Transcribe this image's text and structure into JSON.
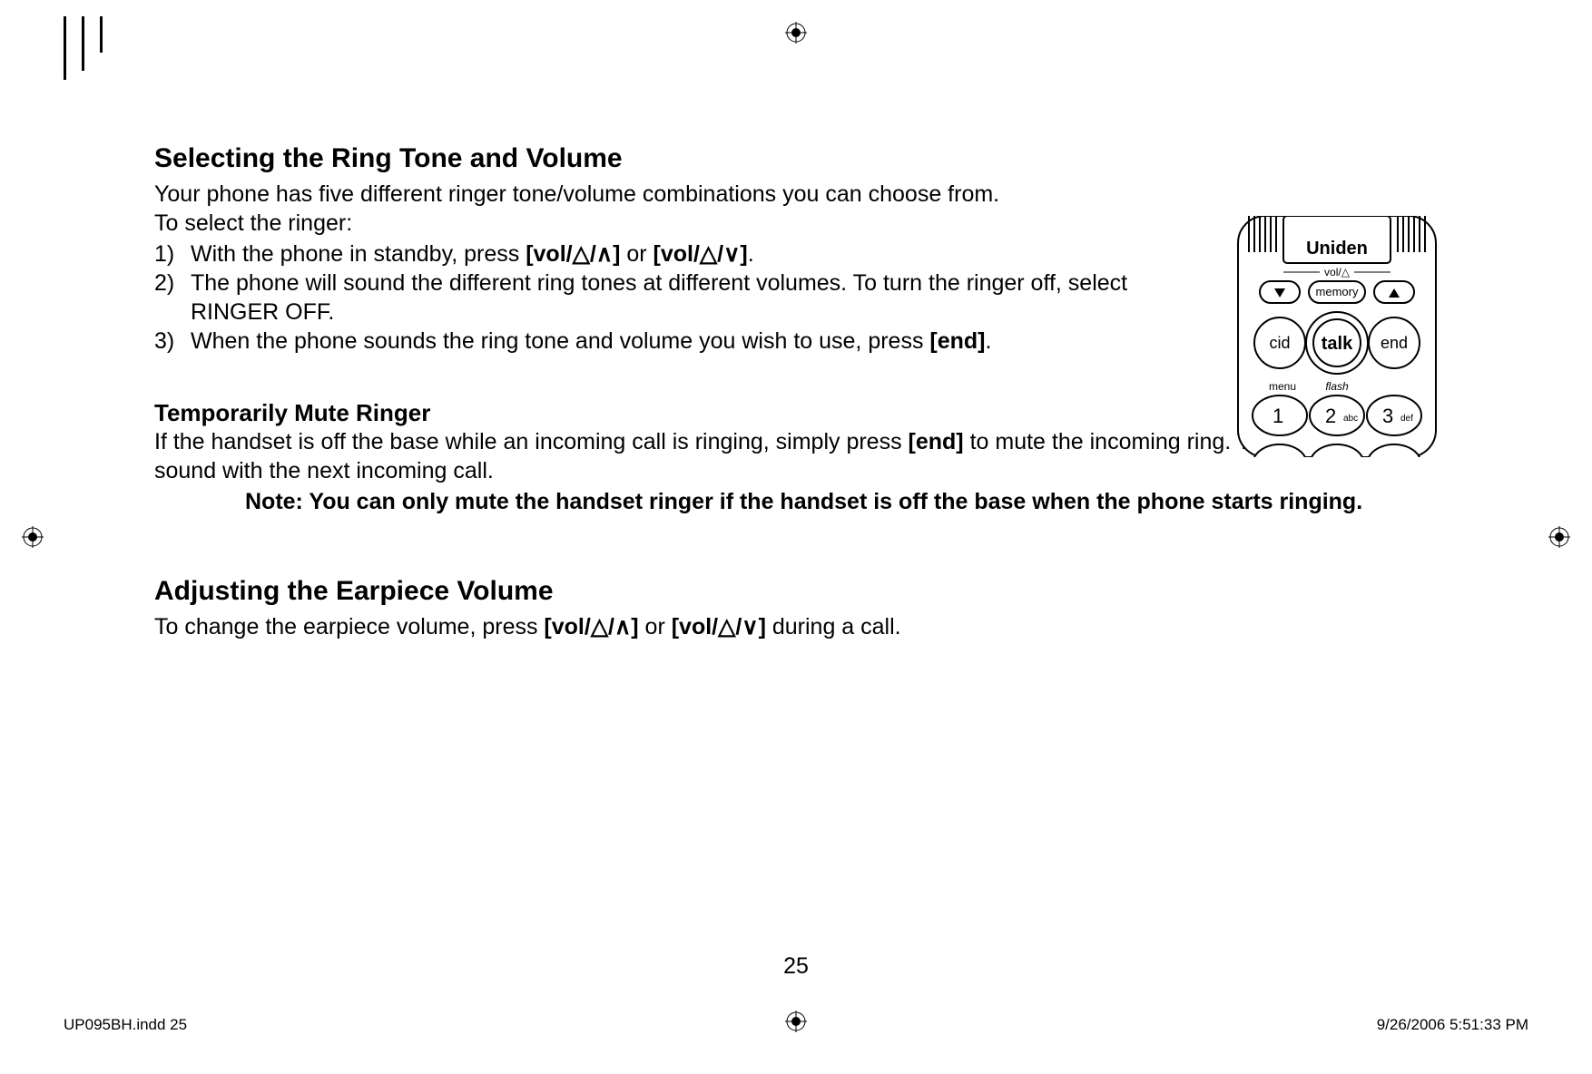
{
  "headings": {
    "h1_a": "Selecting the Ring Tone and Volume",
    "h2_a": "Temporarily Mute Ringer",
    "h1_b": "Adjusting the Earpiece Volume"
  },
  "intro": {
    "line1": "Your phone has five different ringer tone/volume combinations you can choose from.",
    "line2": "To select the ringer:"
  },
  "steps": {
    "s1_num": "1)",
    "s1_a": "With the phone in standby, press ",
    "s1_key1": "[vol/△/∧]",
    "s1_mid": " or ",
    "s1_key2": "[vol/△/∨]",
    "s1_end": ".",
    "s2_num": "2)",
    "s2_text": "The phone will sound the different ring tones at different volumes. To turn the ringer off, select RINGER OFF.",
    "s3_num": "3)",
    "s3_a": "When the phone sounds the ring tone and volume you wish to use, press ",
    "s3_key": "[end]",
    "s3_end": "."
  },
  "mute": {
    "p1_a": "If the handset is off the base while an incoming call is ringing, simply press ",
    "p1_key": "[end]",
    "p1_b": " to mute the incoming ring. The ringer will sound with the next incoming call.",
    "note": "Note: You can only mute the handset ringer if the handset is off the base when the phone starts ringing."
  },
  "earpiece": {
    "p_a": "To change the earpiece volume, press ",
    "p_key1": "[vol/△/∧]",
    "p_mid": " or ",
    "p_key2": "[vol/△/∨]",
    "p_end": " during a call."
  },
  "page_number": "25",
  "footer": {
    "left": "UP095BH.indd   25",
    "right": "9/26/2006   5:51:33 PM"
  },
  "phone": {
    "brand": "Uniden",
    "vol_label": "vol/△",
    "memory": "memory",
    "cid": "cid",
    "talk": "talk",
    "end": "end",
    "menu": "menu",
    "flash": "flash",
    "k1": "1",
    "k2": "2",
    "k2s": "abc",
    "k3": "3",
    "k3s": "def"
  }
}
